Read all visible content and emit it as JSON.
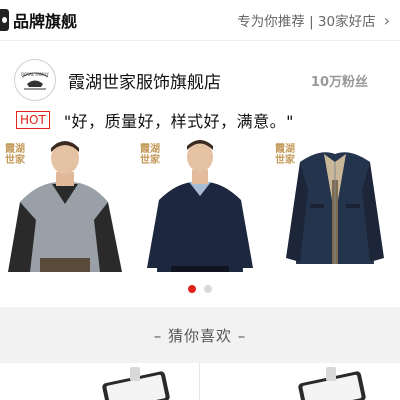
{
  "header": {
    "title": "品牌旗舰",
    "link_text": "专为你推荐 | 30家好店",
    "chevron_icon": "chevron-right-icon"
  },
  "store": {
    "logo_text": "ROYAL FAMILY",
    "name": "霞湖世家服饰旗舰店",
    "fans": "10万粉丝"
  },
  "quote": {
    "badge": "HOT",
    "text": "\"好，质量好，样式好，满意。\""
  },
  "carousel": {
    "products": [
      {
        "mark": "霞湖世家",
        "kind": "grey-sweater-shirt"
      },
      {
        "mark": "霞湖世家",
        "kind": "navy-sweater"
      },
      {
        "mark": "霞湖世家",
        "kind": "navy-jacket"
      }
    ],
    "page_count": 2,
    "active_index": 0
  },
  "guess": {
    "title": "– 猜你喜欢 –"
  },
  "colors": {
    "accent": "#e2231a",
    "muted": "#999999",
    "section_bg": "#f2f2f2"
  }
}
